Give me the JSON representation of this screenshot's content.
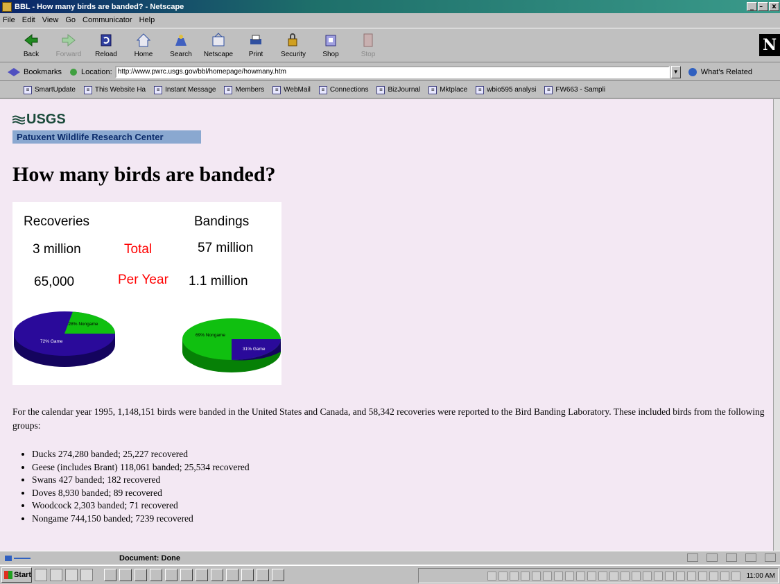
{
  "window": {
    "title": "BBL - How many birds are banded? - Netscape",
    "controls": [
      "_",
      "̵",
      "x"
    ]
  },
  "menu": [
    "File",
    "Edit",
    "View",
    "Go",
    "Communicator",
    "Help"
  ],
  "toolbar": {
    "buttons": [
      {
        "label": "Back",
        "icon": "back-arrow-icon"
      },
      {
        "label": "Forward",
        "icon": "forward-arrow-icon"
      },
      {
        "label": "Reload",
        "icon": "reload-icon"
      },
      {
        "label": "Home",
        "icon": "home-icon"
      },
      {
        "label": "Search",
        "icon": "search-icon"
      },
      {
        "label": "Netscape",
        "icon": "netscape-icon"
      },
      {
        "label": "Print",
        "icon": "print-icon"
      },
      {
        "label": "Security",
        "icon": "security-lock-icon"
      },
      {
        "label": "Shop",
        "icon": "shop-icon"
      },
      {
        "label": "Stop",
        "icon": "stop-icon"
      }
    ],
    "logo": "N"
  },
  "location": {
    "bookmarks_label": "Bookmarks",
    "location_label": "Location:",
    "url": "http://www.pwrc.usgs.gov/bbl/homepage/howmany.htm",
    "related_label": "What's Related"
  },
  "personal_toolbar": [
    "SmartUpdate",
    "This Website Ha",
    "Instant Message",
    "Members",
    "WebMail",
    "Connections",
    "BizJournal",
    "Mktplace",
    "wbio595 analysi",
    "FW663 - Sampli"
  ],
  "page": {
    "logo_text": "USGS",
    "banner": "Patuxent Wildlife Research Center",
    "heading": "How many birds are banded?",
    "figure": {
      "recoveries_label": "Recoveries",
      "bandings_label": "Bandings",
      "total_label": "Total",
      "per_year_label": "Per Year",
      "recoveries_total": "3 million",
      "bandings_total": "57 million",
      "recoveries_per_year": "65,000",
      "bandings_per_year": "1.1 million",
      "pie1_game_label": "72% Game",
      "pie1_nongame_label": "28% Nongame",
      "pie2_nongame_label": "69% Nongame",
      "pie2_game_label": "31% Game",
      "colors": {
        "game": "#2a0a9a",
        "nongame": "#10c010",
        "red": "#ff0000"
      }
    },
    "paragraph": "For the calendar year 1995, 1,148,151 birds were banded in the United States and Canada, and 58,342 recoveries were reported to the Bird Banding Laboratory. These included birds from the following groups:",
    "groups": [
      "Ducks 274,280 banded; 25,227 recovered",
      "Geese (includes Brant) 118,061 banded; 25,534 recovered",
      "Swans 427 banded; 182 recovered",
      "Doves 8,930 banded; 89 recovered",
      "Woodcock 2,303 banded; 71 recovered",
      "Nongame 744,150 banded; 7239 recovered"
    ]
  },
  "status": {
    "text": "Document: Done"
  },
  "taskbar": {
    "start_label": "Start",
    "clock": "11:00 AM"
  }
}
